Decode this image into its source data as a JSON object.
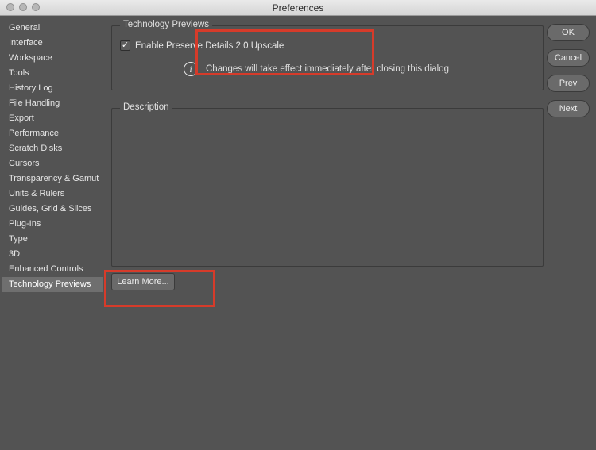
{
  "window": {
    "title": "Preferences"
  },
  "sidebar": {
    "items": [
      {
        "label": "General"
      },
      {
        "label": "Interface"
      },
      {
        "label": "Workspace"
      },
      {
        "label": "Tools"
      },
      {
        "label": "History Log"
      },
      {
        "label": "File Handling"
      },
      {
        "label": "Export"
      },
      {
        "label": "Performance"
      },
      {
        "label": "Scratch Disks"
      },
      {
        "label": "Cursors"
      },
      {
        "label": "Transparency & Gamut"
      },
      {
        "label": "Units & Rulers"
      },
      {
        "label": "Guides, Grid & Slices"
      },
      {
        "label": "Plug-Ins"
      },
      {
        "label": "Type"
      },
      {
        "label": "3D"
      },
      {
        "label": "Enhanced Controls"
      },
      {
        "label": "Technology Previews",
        "selected": true
      }
    ]
  },
  "main": {
    "previews": {
      "legend": "Technology Previews",
      "checkbox_label": "Enable Preserve Details 2.0 Upscale",
      "checkbox_checked": true,
      "info_text": "Changes will take effect immediately after closing this dialog"
    },
    "description": {
      "legend": "Description"
    },
    "learn_more_label": "Learn More..."
  },
  "buttons": {
    "ok": "OK",
    "cancel": "Cancel",
    "prev": "Prev",
    "next": "Next"
  }
}
